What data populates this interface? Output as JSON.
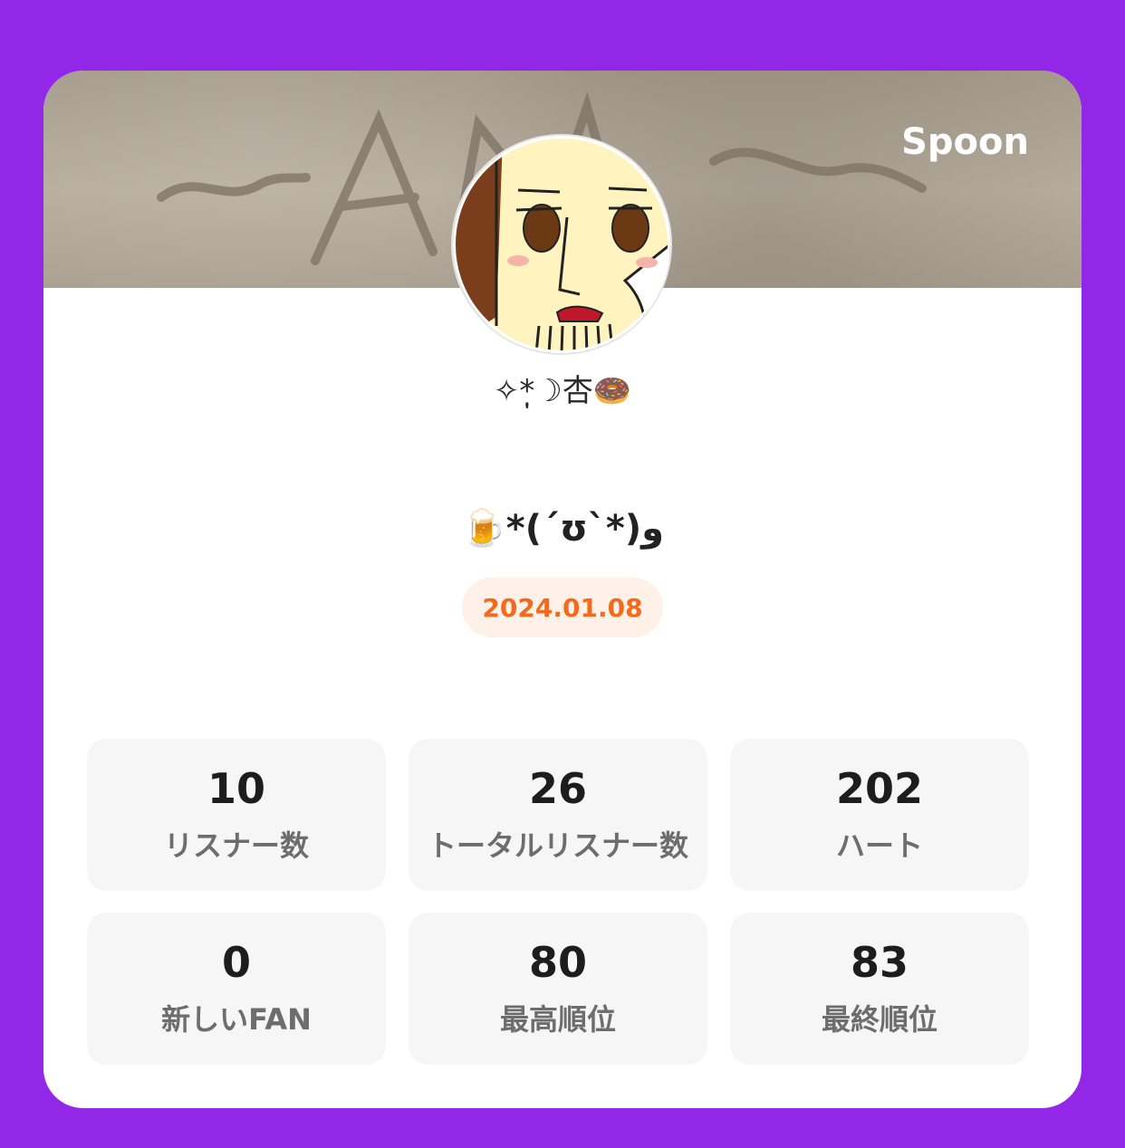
{
  "brand": {
    "name": "Spoon"
  },
  "profile": {
    "username": "✧*̣̩☽杏🍩",
    "headline": "🍺*(´ʊ`*)و",
    "date": "2024.01.08"
  },
  "colors": {
    "background": "#9227e8",
    "card": "#ffffff",
    "date_badge_bg": "#fff0e8",
    "date_badge_text": "#f26b1d",
    "stat_tile_bg": "#f6f6f6"
  },
  "stats": [
    {
      "value": "10",
      "label": "リスナー数"
    },
    {
      "value": "26",
      "label": "トータルリスナー数"
    },
    {
      "value": "202",
      "label": "ハート"
    },
    {
      "value": "0",
      "label": "新しいFAN"
    },
    {
      "value": "80",
      "label": "最高順位"
    },
    {
      "value": "83",
      "label": "最終順位"
    }
  ]
}
